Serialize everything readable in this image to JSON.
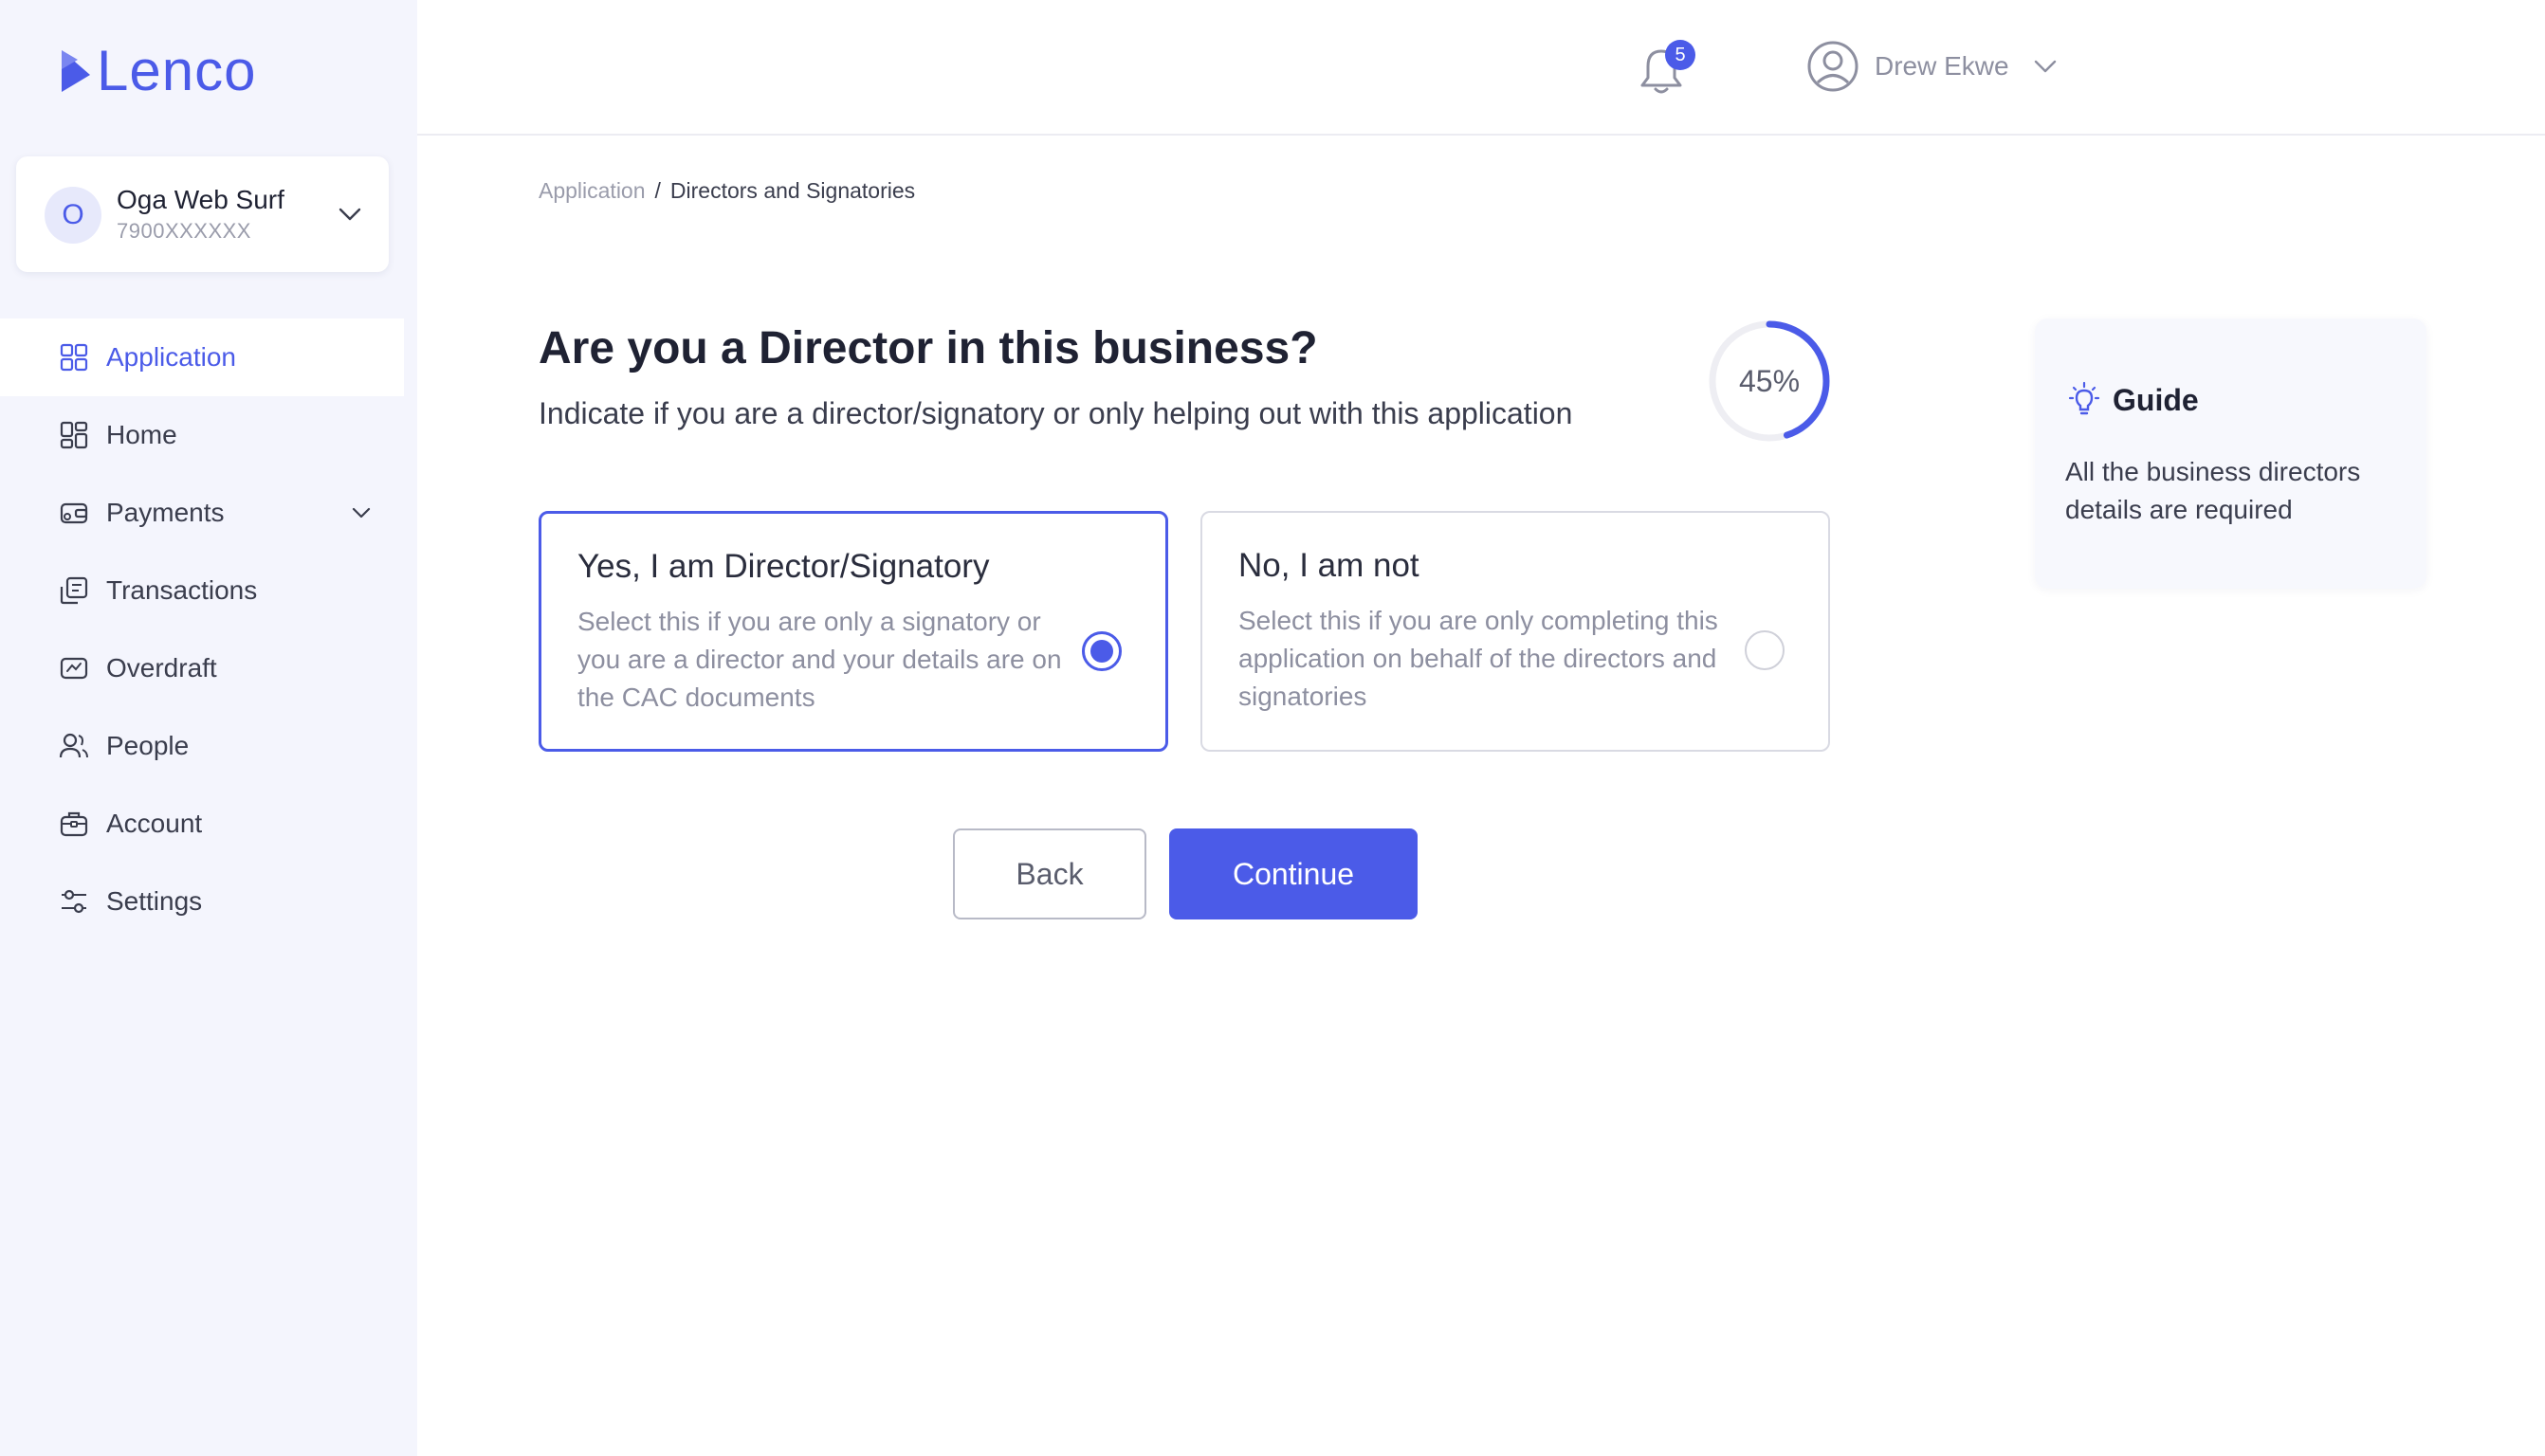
{
  "brand": {
    "name": "Lenco",
    "accent": "#4b5be8"
  },
  "organization": {
    "initial": "O",
    "name": "Oga Web Surf",
    "account_number": "7900XXXXXX"
  },
  "sidebar": {
    "items": [
      {
        "label": "Application",
        "icon": "application-grid-icon",
        "active": true
      },
      {
        "label": "Home",
        "icon": "home-grid-icon"
      },
      {
        "label": "Payments",
        "icon": "payments-icon",
        "expandable": true
      },
      {
        "label": "Transactions",
        "icon": "transactions-icon"
      },
      {
        "label": "Overdraft",
        "icon": "overdraft-icon"
      },
      {
        "label": "People",
        "icon": "people-icon"
      },
      {
        "label": "Account",
        "icon": "account-briefcase-icon"
      },
      {
        "label": "Settings",
        "icon": "settings-sliders-icon"
      }
    ]
  },
  "header": {
    "notification_count": "5",
    "user_name": "Drew Ekwe"
  },
  "breadcrumb": {
    "parent": "Application",
    "separator": "/",
    "current": "Directors and Signatories"
  },
  "question": {
    "title": "Are you a Director in this business?",
    "subtitle": "Indicate if you are a director/signatory or only helping out with this application"
  },
  "progress": {
    "label": "45%",
    "value": 0.45
  },
  "options": [
    {
      "title": "Yes, I am Director/Signatory",
      "description": "Select this if you are only a signatory or you are a director and your details are on the CAC documents",
      "selected": true
    },
    {
      "title": "No, I am not",
      "description": "Select this if you are only completing this application on behalf of the directors and signatories",
      "selected": false
    }
  ],
  "buttons": {
    "back": "Back",
    "continue": "Continue"
  },
  "guide": {
    "title": "Guide",
    "text": "All the business directors details are required"
  }
}
